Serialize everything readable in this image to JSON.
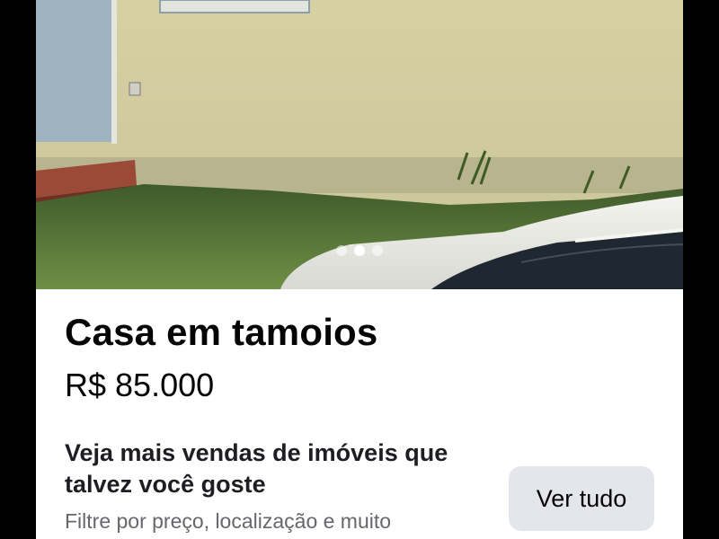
{
  "listing": {
    "title": "Casa em tamoios",
    "price": "R$ 85.000",
    "carousel": {
      "count": 3,
      "active_index": 1
    }
  },
  "recommendations": {
    "heading": "Veja mais vendas de imóveis que talvez você goste",
    "subtext": "Filtre por preço, localização e muito",
    "see_all_label": "Ver tudo"
  },
  "colors": {
    "background": "#000000",
    "card": "#ffffff",
    "button": "#e4e6eb",
    "secondary_text": "#65676b"
  }
}
